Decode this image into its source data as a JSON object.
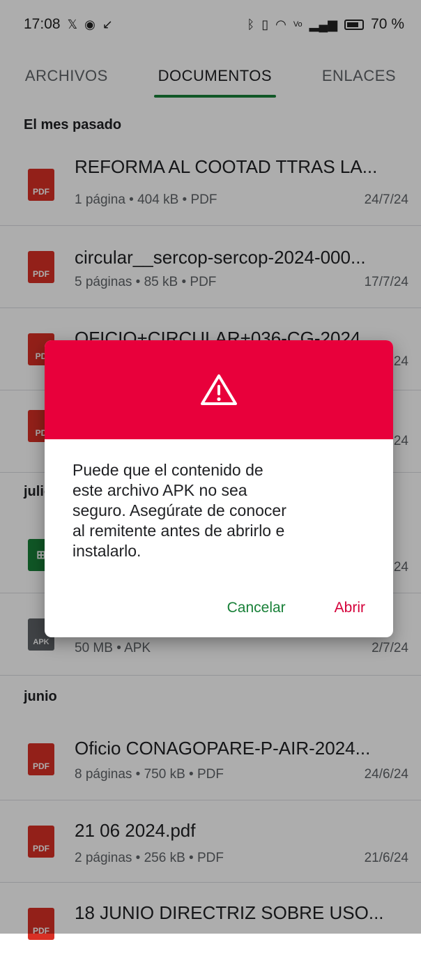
{
  "status_bar": {
    "time": "17:08",
    "left_icons": [
      "x-icon",
      "chrome-icon",
      "missed-call-icon"
    ],
    "right_icons": [
      "bluetooth-icon",
      "vibrate-icon",
      "wifi-icon",
      "volte-icon",
      "signal-icon"
    ],
    "battery_icon": "battery-icon",
    "battery": "70 %"
  },
  "tabs": [
    {
      "label": "ARCHIVOS",
      "active": false
    },
    {
      "label": "DOCUMENTOS",
      "active": true
    },
    {
      "label": "ENLACES",
      "active": false
    }
  ],
  "sections": {
    "last_month": "El mes pasado",
    "july": "julio",
    "june": "junio"
  },
  "files": [
    {
      "type_label": "PDF",
      "title": "REFORMA AL COOTAD TTRAS LA...",
      "meta": "1 página • 404 kB • PDF",
      "date": "24/7/24"
    },
    {
      "type_label": "PDF",
      "title": "circular__sercop-sercop-2024-000...",
      "meta": "5 páginas • 85 kB • PDF",
      "date": "17/7/24"
    },
    {
      "type_label": "PD",
      "title": "OFICIO+CIRCULAR+036-CG-2024...",
      "meta": "",
      "date": "24"
    },
    {
      "type_label": "PD",
      "title": "...",
      "meta": "",
      "date": "24"
    },
    {
      "type_label": "⊞",
      "title": "..",
      "meta": "",
      "date": "24"
    },
    {
      "type_label": "APK",
      "title": "",
      "meta": "50 MB • APK",
      "date": "2/7/24"
    },
    {
      "type_label": "PDF",
      "title": "Oficio CONAGOPARE-P-AIR-2024...",
      "meta": "8 páginas • 750 kB • PDF",
      "date": "24/6/24"
    },
    {
      "type_label": "PDF",
      "title": "21 06 2024.pdf",
      "meta": "2 páginas • 256 kB • PDF",
      "date": "21/6/24"
    },
    {
      "type_label": "PDF",
      "title": "18 JUNIO DIRECTRIZ SOBRE USO...",
      "meta": "",
      "date": ""
    }
  ],
  "dialog": {
    "icon": "warning-icon",
    "message_lines": [
      "Puede que el contenido de",
      "este archivo APK no sea",
      "seguro. Asegúrate de conocer",
      "al remitente antes de abrirlo e",
      "instalarlo."
    ],
    "cancel_label": "Cancelar",
    "open_label": "Abrir"
  },
  "colors": {
    "accent_green": "#188038",
    "dialog_header": "#e8003b",
    "open_button": "#d4003a",
    "pdf_red": "#d93025"
  }
}
